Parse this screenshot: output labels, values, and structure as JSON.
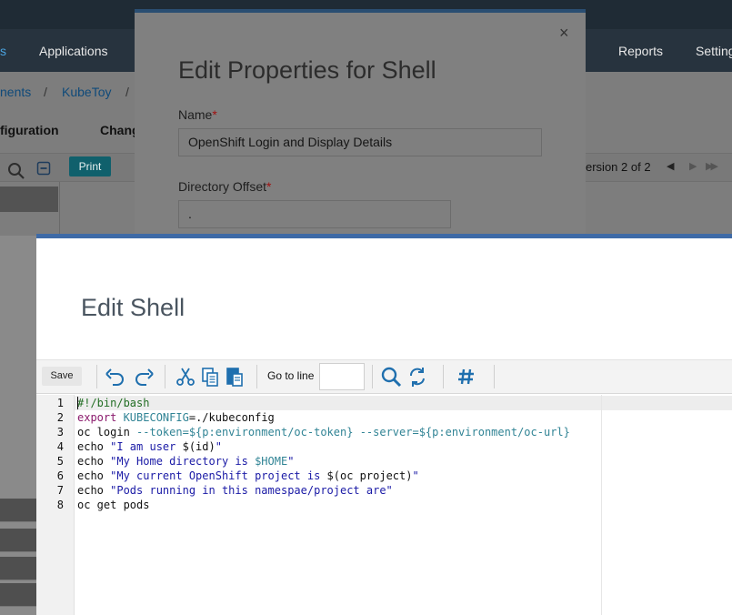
{
  "background_app": {
    "nav": {
      "active_partial": "s",
      "items": [
        "Applications",
        "Reports",
        "Setting"
      ]
    },
    "breadcrumb": {
      "items": [
        "nents",
        "KubeToy"
      ],
      "separator": "/"
    },
    "sections": [
      "figuration",
      "Chang"
    ],
    "toolbar": {
      "print_label": "Print",
      "version_text": "ersion 2 of 2",
      "pager_prev": "◀",
      "pager_next": "▶",
      "pager_last": "▶▶"
    }
  },
  "properties_dialog": {
    "title": "Edit Properties for Shell",
    "close_glyph": "×",
    "required_mark": "*",
    "fields": [
      {
        "label": "Name",
        "value": "OpenShift Login and Display Details"
      },
      {
        "label": "Directory Offset",
        "value": "."
      }
    ]
  },
  "shell_dialog": {
    "title": "Edit Shell",
    "toolbar": {
      "save_label": "Save",
      "goto_label": "Go to line",
      "goto_value": ""
    },
    "icons": {
      "undo": "undo-icon",
      "redo": "redo-icon",
      "cut": "cut-icon",
      "copy": "copy-icon",
      "paste": "paste-icon",
      "search": "search-icon",
      "replace": "replace-icon",
      "toggle_comment": "hash-icon"
    },
    "editor": {
      "line_numbers": [
        "1",
        "2",
        "3",
        "4",
        "5",
        "6",
        "7",
        "8"
      ],
      "lines": {
        "l1": {
          "comment": "#!/bin/bash"
        },
        "l2": {
          "kw": "export",
          "rest": " KUBECONFIG",
          "rest2": "=./kubeconfig"
        },
        "l3": {
          "cmd": "oc login ",
          "opt1": "--token=${p:environment/oc-token}",
          "sp": " ",
          "opt2": "--server=${p:environment/oc-url}"
        },
        "l4": {
          "cmd": "echo ",
          "str1": "\"I am user ",
          "plain": "$(id)",
          "str2": "\""
        },
        "l5": {
          "cmd": "echo ",
          "str1": "\"My Home directory is ",
          "var": "$HOME",
          "str2": "\""
        },
        "l6": {
          "cmd": "echo ",
          "str1": "\"My current OpenShift project is ",
          "plain": "$(oc project)",
          "str2": "\""
        },
        "l7": {
          "cmd": "echo ",
          "str1": "\"Pods running in this namespae/project are\""
        },
        "l8": {
          "cmd": "oc get pods"
        }
      }
    }
  },
  "colors": {
    "front_dialog_border": "#3e6aa6",
    "back_dialog_border": "#2a4e72",
    "print_button": "#10606c",
    "icon_blue": "#1f6fae"
  }
}
